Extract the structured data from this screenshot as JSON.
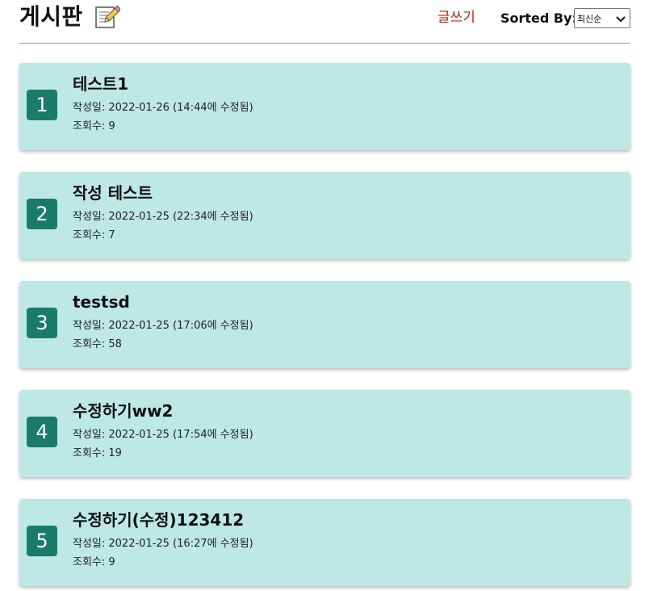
{
  "header": {
    "title": "게시판",
    "write_label": "글쓰기",
    "sort_label": "Sorted By:",
    "sort_selected": "최신순"
  },
  "posts": [
    {
      "number": "1",
      "title": "테스트1",
      "date_line": "작성일: 2022-01-26 (14:44에 수정됨)",
      "views_line": "조회수: 9"
    },
    {
      "number": "2",
      "title": "작성 테스트",
      "date_line": "작성일: 2022-01-25 (22:34에 수정됨)",
      "views_line": "조회수: 7"
    },
    {
      "number": "3",
      "title": "testsd",
      "date_line": "작성일: 2022-01-25 (17:06에 수정됨)",
      "views_line": "조회수: 58"
    },
    {
      "number": "4",
      "title": "수정하기ww2",
      "date_line": "작성일: 2022-01-25 (17:54에 수정됨)",
      "views_line": "조회수: 19"
    },
    {
      "number": "5",
      "title": "수정하기(수정)123412",
      "date_line": "작성일: 2022-01-25 (16:27에 수정됨)",
      "views_line": "조회수: 9"
    }
  ],
  "colors": {
    "card_bg": "#bde8e3",
    "badge_bg": "#1a7b6a",
    "write_link": "#b02a1a"
  },
  "icons": {
    "title_icon": "memo-icon",
    "select_icon": "chevron-down-icon"
  }
}
